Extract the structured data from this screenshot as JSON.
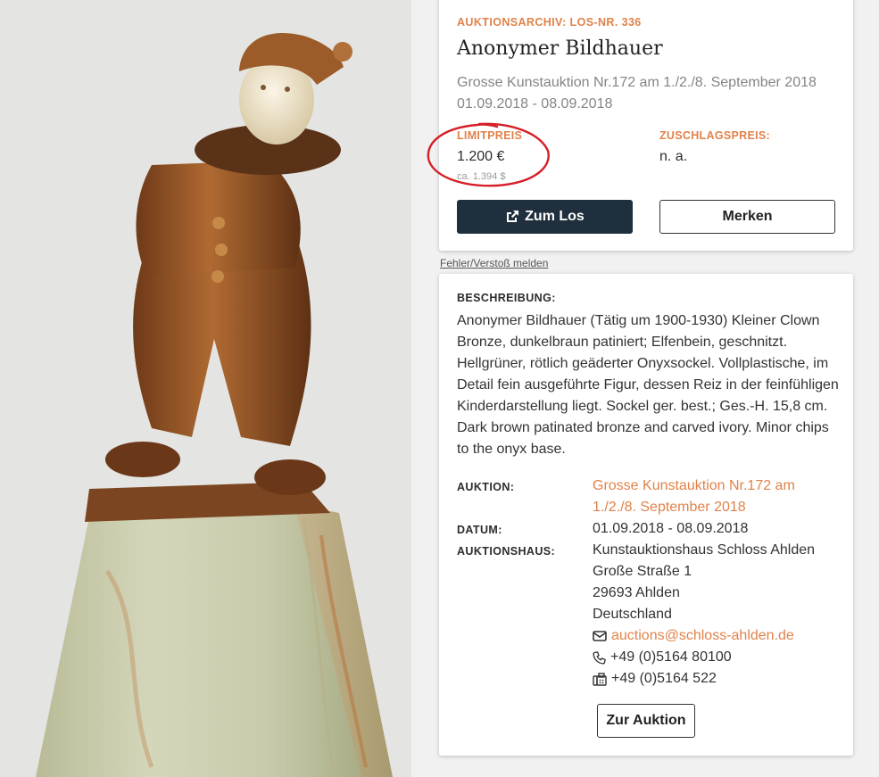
{
  "image": {
    "alt_icon": "clown-figurine-photo",
    "colors": {
      "bronze": "#9a5a2a",
      "ivory": "#efe6d4",
      "onyx": "#c9c9ac",
      "background": "#e5e5e3"
    }
  },
  "lot": {
    "archive_label": "AUKTIONSARCHIV: LOS-NR. 336",
    "title": "Anonymer Bildhauer",
    "subtitle_line1": "Grosse Kunstauktion Nr.172 am 1./2./8. September 2018",
    "subtitle_line2": "01.09.2018 - 08.09.2018",
    "limit_label": "LIMITPREIS",
    "limit_value": "1.200 €",
    "limit_usd": "ca. 1.394 $",
    "hammer_label": "ZUSCHLAGSPREIS:",
    "hammer_value": "n. a.",
    "btn_zum_los": "Zum Los",
    "btn_merken": "Merken"
  },
  "report_link": "Fehler/Verstoß melden",
  "description": {
    "label": "BESCHREIBUNG:",
    "text": "Anonymer Bildhauer (Tätig um 1900-1930) Kleiner Clown Bronze, dunkelbraun patiniert; Elfenbein, geschnitzt. Hellgrüner, rötlich geäderter Onyxsockel. Vollplastische, im Detail fein ausgeführte Figur, dessen Reiz in der feinfühligen Kinderdarstellung liegt. Sockel ger. best.; Ges.-H. 15,8 cm. Dark brown patinated bronze and carved ivory. Minor chips to the onyx base.",
    "auction_label": "AUKTION:",
    "auction_line1": "Grosse Kunstauktion Nr.172 am",
    "auction_line2": "1./2./8. September 2018",
    "date_label": "DATUM:",
    "date_value": "01.09.2018 - 08.09.2018",
    "house_label": "AUKTIONSHAUS:",
    "house_name": "Kunstauktionshaus Schloss Ahlden",
    "street": "Große Straße 1",
    "city": "29693 Ahlden",
    "country": "Deutschland",
    "email": "auctions@schloss-ahlden.de",
    "phone": "+49 (0)5164 80100",
    "fax": "+49 (0)5164 522",
    "btn_zur_auktion": "Zur Auktion"
  },
  "accent_color": "#e0824a",
  "dark_button_color": "#1f2f3d"
}
